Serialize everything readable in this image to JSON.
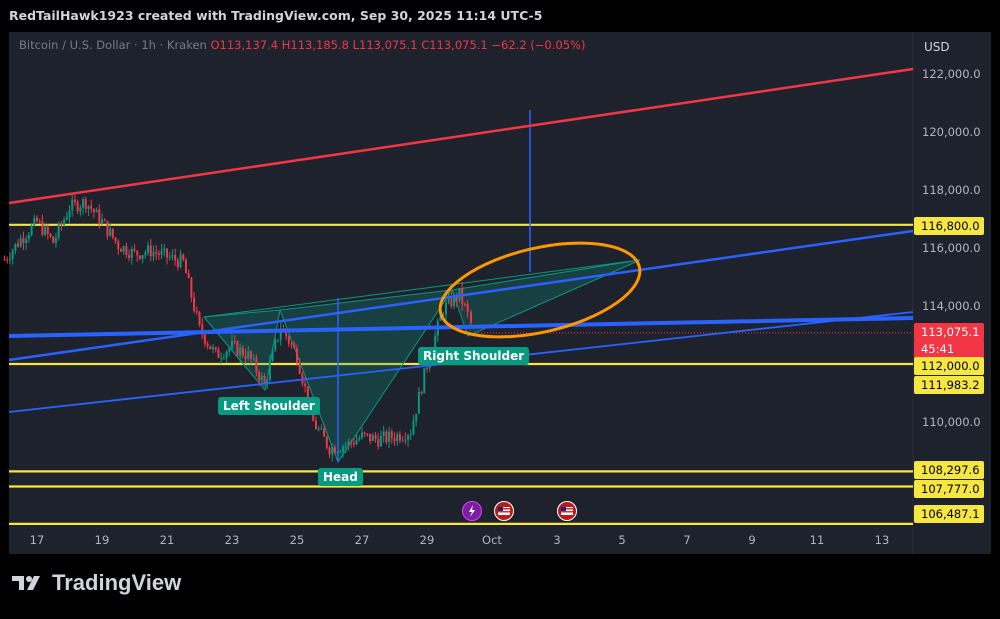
{
  "header": {
    "title": "RedTailHawk1923 created with TradingView.com, Sep 30, 2025 11:14 UTC-5"
  },
  "legend": {
    "symbol": "Bitcoin / U.S. Dollar · 1h · Kraken",
    "open": "O113,137.4",
    "high": "H113,185.8",
    "low": "L113,075.1",
    "close": "C113,075.1",
    "change": "−62.2 (−0.05%)"
  },
  "currency": "USD",
  "price_axis": {
    "ticks": [
      "122,000.0",
      "120,000.0",
      "118,000.0",
      "116,000.0",
      "114,000.0",
      "110,000.0"
    ],
    "tags": [
      {
        "label": "116,800.0",
        "kind": "yellow"
      },
      {
        "label": "113,075.1",
        "kind": "red"
      },
      {
        "label": "45:41",
        "kind": "red"
      },
      {
        "label": "112,000.0",
        "kind": "yellow"
      },
      {
        "label": "111,983.2",
        "kind": "yellow"
      },
      {
        "label": "108,297.6",
        "kind": "yellow"
      },
      {
        "label": "107,777.0",
        "kind": "yellow"
      },
      {
        "label": "106,487.1",
        "kind": "yellow"
      }
    ]
  },
  "time_axis": {
    "ticks": [
      "17",
      "19",
      "21",
      "23",
      "25",
      "27",
      "29",
      "Oct",
      "3",
      "5",
      "7",
      "9",
      "11",
      "13"
    ]
  },
  "callouts": {
    "left_shoulder": "Left Shoulder",
    "head": "Head",
    "right_shoulder": "Right Shoulder"
  },
  "footer": {
    "brand": "TradingView"
  },
  "colors": {
    "background": "#1e222d",
    "yellow_lines": "#f5e642",
    "red_channel": "#f23645",
    "blue_trend": "#2962ff",
    "orange_circle": "#ff9800",
    "pattern_fill": "#089981"
  },
  "chart_data": {
    "type": "candlestick",
    "symbol": "Bitcoin / U.S. Dollar",
    "interval": "1h",
    "exchange": "Kraken",
    "x_range": [
      "Sep 16",
      "Oct 14"
    ],
    "y_range": [
      106300,
      122700
    ],
    "horizontal_levels": [
      116800.0,
      112000.0,
      111983.2,
      108297.6,
      107777.0,
      106487.1
    ],
    "last_price": 113075.1,
    "pattern": "inverse head and shoulders",
    "price_path": [
      [
        "Sep 16 00:00",
        115600
      ],
      [
        "Sep 16 12:00",
        116300
      ],
      [
        "Sep 17 00:00",
        116900
      ],
      [
        "Sep 17 12:00",
        116200
      ],
      [
        "Sep 18 00:00",
        117400
      ],
      [
        "Sep 18 12:00",
        117600
      ],
      [
        "Sep 19 00:00",
        116900
      ],
      [
        "Sep 19 12:00",
        116100
      ],
      [
        "Sep 20 00:00",
        115800
      ],
      [
        "Sep 20 12:00",
        115900
      ],
      [
        "Sep 21 00:00",
        115700
      ],
      [
        "Sep 21 12:00",
        115500
      ],
      [
        "Sep 22 00:00",
        113200
      ],
      [
        "Sep 22 12:00",
        112300
      ],
      [
        "Sep 23 00:00",
        112600
      ],
      [
        "Sep 23 12:00",
        112300
      ],
      [
        "Sep 24 00:00",
        111300
      ],
      [
        "Sep 24 12:00",
        113300
      ],
      [
        "Sep 25 00:00",
        112300
      ],
      [
        "Sep 25 12:00",
        110000
      ],
      [
        "Sep 26 00:00",
        109100
      ],
      [
        "Sep 26 12:00",
        109200
      ],
      [
        "Sep 27 00:00",
        109500
      ],
      [
        "Sep 27 12:00",
        109400
      ],
      [
        "Sep 28 00:00",
        109500
      ],
      [
        "Sep 28 12:00",
        109700
      ],
      [
        "Sep 29 00:00",
        112000
      ],
      [
        "Sep 29 12:00",
        113900
      ],
      [
        "Sep 30 00:00",
        114400
      ],
      [
        "Sep 30 06:00",
        113700
      ],
      [
        "Sep 30 11:00",
        113075
      ]
    ]
  }
}
